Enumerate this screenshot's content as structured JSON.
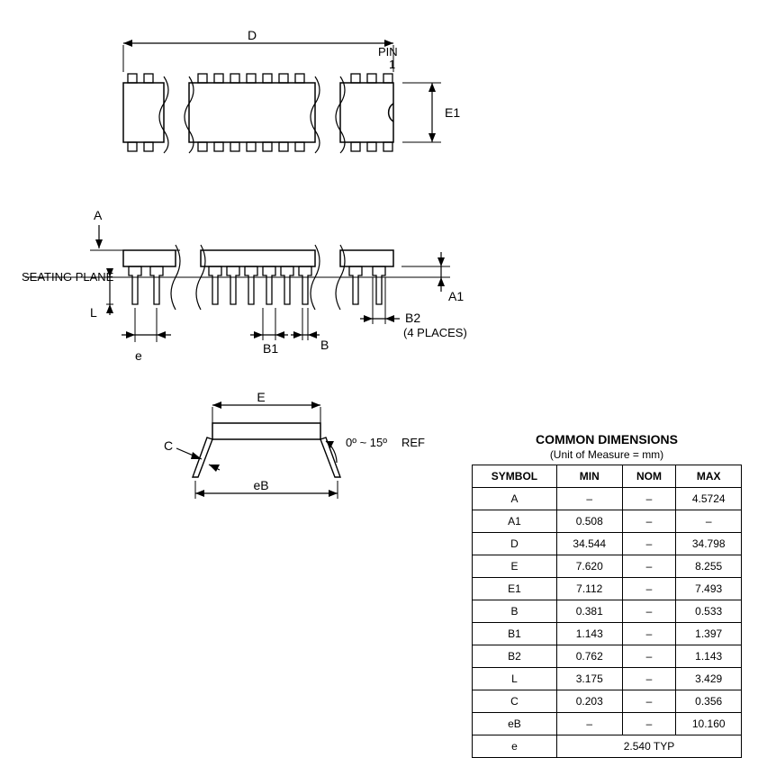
{
  "chart_data": {
    "type": "table",
    "title": "COMMON DIMENSIONS",
    "subtitle": "(Unit of Measure = mm)",
    "columns": [
      "SYMBOL",
      "MIN",
      "NOM",
      "MAX"
    ],
    "rows": [
      {
        "sym": "A",
        "min": "–",
        "nom": "–",
        "max": "4.5724"
      },
      {
        "sym": "A1",
        "min": "0.508",
        "nom": "–",
        "max": "–"
      },
      {
        "sym": "D",
        "min": "34.544",
        "nom": "–",
        "max": "34.798"
      },
      {
        "sym": "E",
        "min": "7.620",
        "nom": "–",
        "max": "8.255"
      },
      {
        "sym": "E1",
        "min": "7.112",
        "nom": "–",
        "max": "7.493"
      },
      {
        "sym": "B",
        "min": "0.381",
        "nom": "–",
        "max": "0.533"
      },
      {
        "sym": "B1",
        "min": "1.143",
        "nom": "–",
        "max": "1.397"
      },
      {
        "sym": "B2",
        "min": "0.762",
        "nom": "–",
        "max": "1.143"
      },
      {
        "sym": "L",
        "min": "3.175",
        "nom": "–",
        "max": "3.429"
      },
      {
        "sym": "C",
        "min": "0.203",
        "nom": "–",
        "max": "0.356"
      },
      {
        "sym": "eB",
        "min": "–",
        "nom": "–",
        "max": "10.160"
      }
    ],
    "final_row": {
      "sym": "e",
      "value": "2.540 TYP"
    }
  },
  "labels": {
    "D": "D",
    "PIN": "PIN",
    "PIN1": "1",
    "E1": "E1",
    "A": "A",
    "SEATING": "SEATING PLANE",
    "L": "L",
    "e": "e",
    "B1": "B1",
    "B": "B",
    "B2": "B2",
    "B2note": "(4 PLACES)",
    "A1": "A1",
    "E": "E",
    "C": "C",
    "eB": "eB",
    "angle": "0º ~ 15º",
    "REF": "REF"
  }
}
